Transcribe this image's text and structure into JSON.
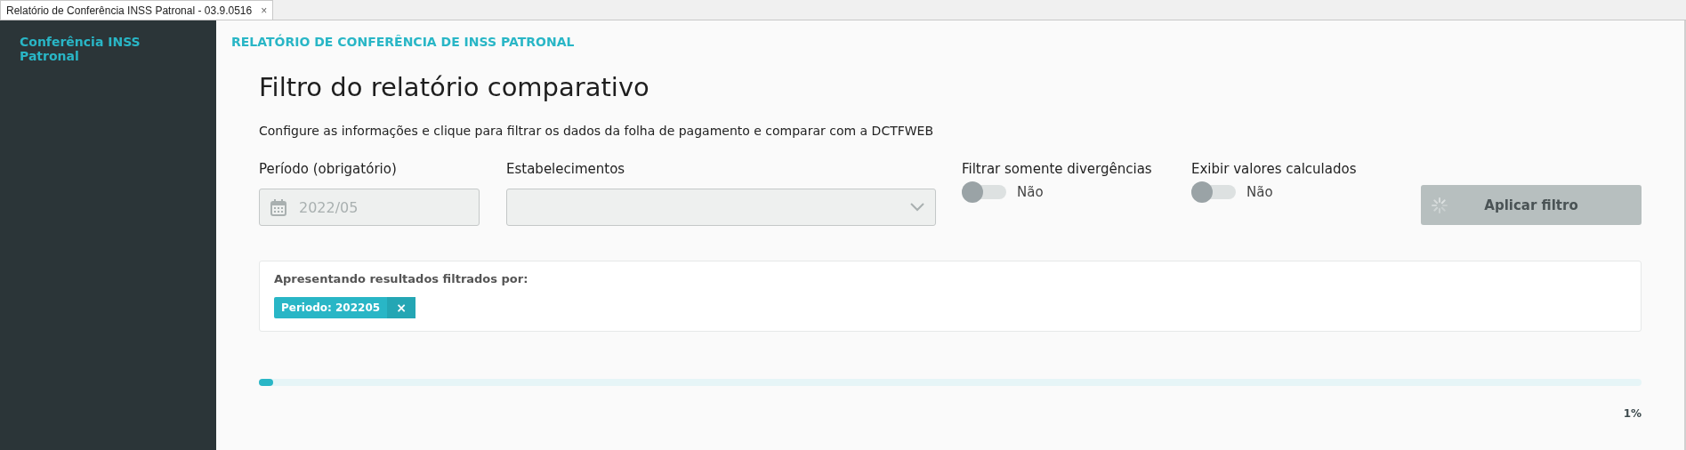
{
  "window_tab": {
    "title": "Relatório de Conferência INSS Patronal - 03.9.0516",
    "close": "×"
  },
  "sidebar": {
    "items": [
      {
        "label": "Conferência INSS Patronal",
        "selected": true
      }
    ]
  },
  "header": "RELATÓRIO DE CONFERÊNCIA DE INSS PATRONAL",
  "title": "Filtro do relatório comparativo",
  "description": "Configure as informações e clique para filtrar os dados da folha de pagamento e comparar com a DCTFWEB",
  "period": {
    "label": "Período (obrigatório)",
    "value": "2022/05",
    "disabled": true
  },
  "establishments": {
    "label": "Estabelecimentos",
    "disabled": true
  },
  "switches": [
    {
      "label": "Filtrar somente divergências",
      "on": false,
      "state_text": "Não"
    },
    {
      "label": "Exibir valores calculados",
      "on": false,
      "state_text": "Não"
    }
  ],
  "apply_button": {
    "label": "Aplicar filtro",
    "disabled": true,
    "loading": true
  },
  "results": {
    "heading": "Apresentando resultados filtrados por:",
    "tags": [
      {
        "label": "Periodo: 202205",
        "remove": "×"
      }
    ]
  },
  "progress": {
    "level": 0.01,
    "reading": "1%"
  }
}
